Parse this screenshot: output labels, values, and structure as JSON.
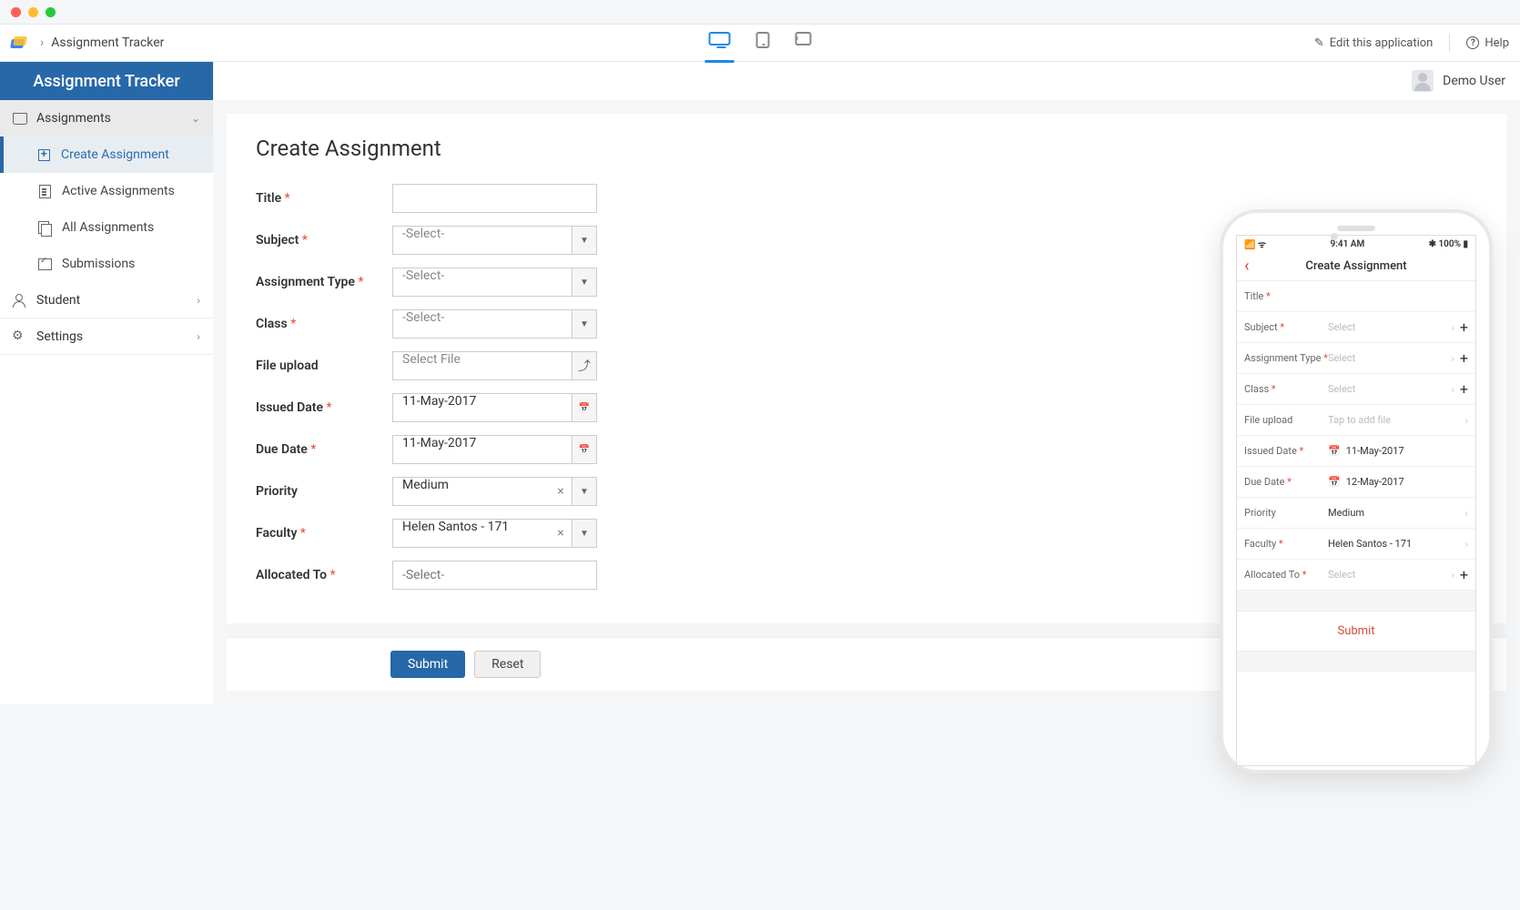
{
  "breadcrumb": {
    "app": "Assignment Tracker"
  },
  "topbar": {
    "edit": "Edit this application",
    "help": "Help"
  },
  "user": {
    "name": "Demo User"
  },
  "sidebar": {
    "title": "Assignment Tracker",
    "sections": [
      {
        "label": "Assignments",
        "open": true,
        "items": [
          {
            "label": "Create Assignment",
            "active": true
          },
          {
            "label": "Active Assignments"
          },
          {
            "label": "All Assignments"
          },
          {
            "label": "Submissions"
          }
        ]
      },
      {
        "label": "Student"
      },
      {
        "label": "Settings"
      }
    ]
  },
  "page": {
    "title": "Create Assignment",
    "fields": {
      "title": {
        "label": "Title",
        "required": true,
        "value": ""
      },
      "subject": {
        "label": "Subject",
        "required": true,
        "placeholder": "-Select-"
      },
      "atype": {
        "label": "Assignment Type",
        "required": true,
        "placeholder": "-Select-"
      },
      "class": {
        "label": "Class",
        "required": true,
        "placeholder": "-Select-"
      },
      "file": {
        "label": "File upload",
        "required": false,
        "placeholder": "Select File"
      },
      "issued": {
        "label": "Issued Date",
        "required": true,
        "value": "11-May-2017"
      },
      "due": {
        "label": "Due Date",
        "required": true,
        "value": "11-May-2017"
      },
      "priority": {
        "label": "Priority",
        "required": false,
        "value": "Medium"
      },
      "faculty": {
        "label": "Faculty",
        "required": true,
        "value": "Helen Santos - 171"
      },
      "allocated": {
        "label": "Allocated To",
        "required": true,
        "placeholder": "-Select-"
      }
    },
    "buttons": {
      "submit": "Submit",
      "reset": "Reset"
    }
  },
  "phone": {
    "time": "9:41 AM",
    "battery": "100%",
    "header": "Create Assignment",
    "rows": {
      "title": {
        "label": "Title",
        "required": true,
        "value": ""
      },
      "subject": {
        "label": "Subject",
        "required": true,
        "placeholder": "Select"
      },
      "atype": {
        "label": "Assignment Type",
        "required": true,
        "placeholder": "Select"
      },
      "class": {
        "label": "Class",
        "required": true,
        "placeholder": "Select"
      },
      "file": {
        "label": "File upload",
        "required": false,
        "placeholder": "Tap to add file"
      },
      "issued": {
        "label": "Issued Date",
        "required": true,
        "value": "11-May-2017"
      },
      "due": {
        "label": "Due Date",
        "required": true,
        "value": "12-May-2017"
      },
      "priority": {
        "label": "Priority",
        "required": false,
        "value": "Medium"
      },
      "faculty": {
        "label": "Faculty",
        "required": true,
        "value": "Helen Santos - 171"
      },
      "allocated": {
        "label": "Allocated To",
        "required": true,
        "placeholder": "Select"
      }
    },
    "submit": "Submit"
  }
}
